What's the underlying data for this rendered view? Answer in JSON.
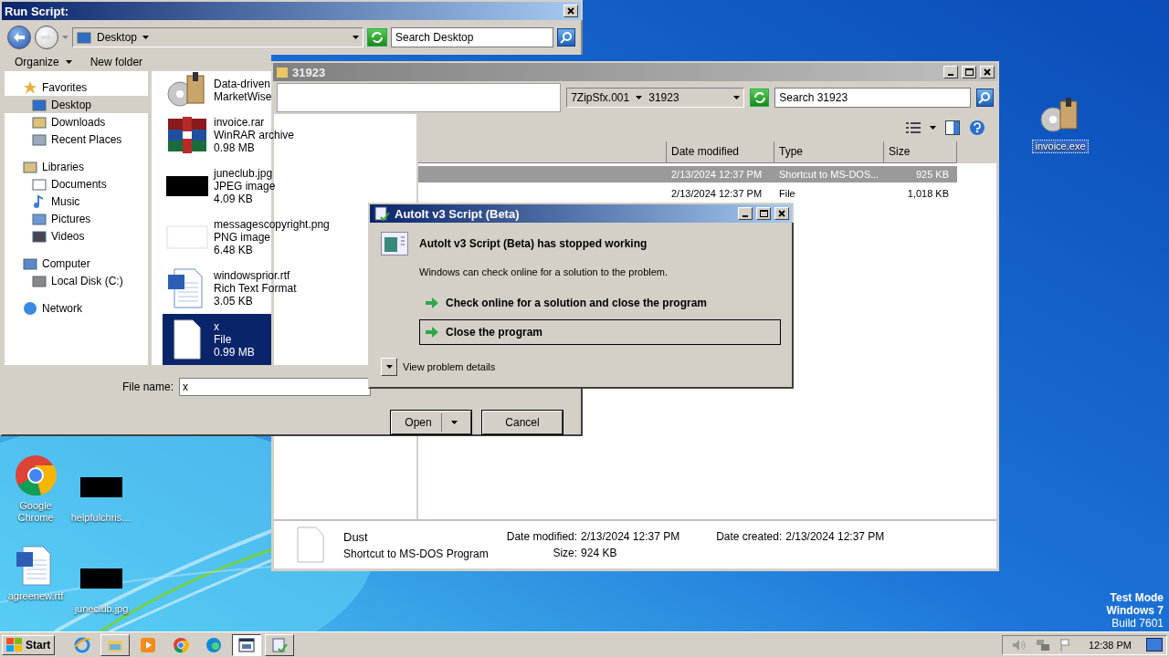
{
  "desktop": {
    "icons": [
      {
        "label": "Google Chrome",
        "kind": "chrome",
        "selected": false
      },
      {
        "label": "helpfulchris…",
        "kind": "dark-image",
        "selected": false
      },
      {
        "label": "agreenew.rtf",
        "kind": "word",
        "selected": false
      },
      {
        "label": "juneclub.jpg",
        "kind": "dark-image",
        "selected": false
      },
      {
        "label": "invoice.exe",
        "kind": "setup",
        "selected": true
      }
    ],
    "system_text": [
      "Test Mode",
      "Windows 7",
      "Build 7601"
    ]
  },
  "run_script": {
    "title": "Run Script:",
    "address": "Desktop",
    "search": {
      "placeholder": "Search Desktop"
    },
    "toolbar": [
      {
        "label": "Organize",
        "kind": "menu"
      },
      {
        "label": "New folder",
        "kind": "button"
      }
    ],
    "navigation": [
      {
        "label": "Favorites",
        "kind": "star",
        "selected": false,
        "children": [
          {
            "label": "Desktop",
            "kind": "desktop",
            "selected": true
          },
          {
            "label": "Downloads",
            "kind": "downloads",
            "selected": false
          },
          {
            "label": "Recent Places",
            "kind": "recent",
            "selected": false
          }
        ]
      },
      {
        "label": "Libraries",
        "kind": "library",
        "selected": false,
        "children": [
          {
            "label": "Documents",
            "kind": "document",
            "selected": false
          },
          {
            "label": "Music",
            "kind": "music",
            "selected": false
          },
          {
            "label": "Pictures",
            "kind": "picture",
            "selected": false
          },
          {
            "label": "Videos",
            "kind": "video",
            "selected": false
          }
        ]
      },
      {
        "label": "Computer",
        "kind": "computer",
        "selected": false,
        "children": [
          {
            "label": "Local Disk (C:)",
            "kind": "disk",
            "selected": false
          }
        ]
      },
      {
        "label": "Network",
        "kind": "network",
        "selected": false
      }
    ],
    "files": [
      {
        "kind": "setup",
        "lines": [
          "Data-driven",
          "MarketWise"
        ],
        "selected": false
      },
      {
        "kind": "archive",
        "lines": [
          "invoice.rar",
          "WinRAR archive",
          "0.98 MB"
        ],
        "selected": false
      },
      {
        "kind": "dark-image",
        "lines": [
          "juneclub.jpg",
          "JPEG image",
          "4.09 KB"
        ],
        "selected": false
      },
      {
        "kind": "blank-image",
        "lines": [
          "messagescopyright.png",
          "PNG image",
          "6.48 KB"
        ],
        "selected": false
      },
      {
        "kind": "word",
        "lines": [
          "windowsprior.rtf",
          "Rich Text Format",
          "3.05 KB"
        ],
        "selected": false
      },
      {
        "kind": "file",
        "lines": [
          "x",
          "File",
          "0.99 MB"
        ],
        "selected": true
      }
    ],
    "file_name": {
      "label": "File name:",
      "value": "x"
    },
    "buttons": [
      {
        "label": "Open",
        "kind": "split"
      },
      {
        "label": "Cancel",
        "kind": "plain"
      }
    ]
  },
  "explorer": {
    "title": "31923",
    "breadcrumb": [
      "7ZipSfx.001",
      "31923"
    ],
    "search": {
      "placeholder": "Search 31923"
    },
    "columns": [
      "Date modified",
      "Type",
      "Size"
    ],
    "rows": [
      {
        "cells": [
          "2/13/2024 12:37 PM",
          "Shortcut to MS-DOS...",
          "925 KB"
        ],
        "selected": true
      },
      {
        "cells": [
          "2/13/2024 12:37 PM",
          "File",
          "1,018 KB"
        ],
        "selected": false
      }
    ],
    "details": {
      "name": "Dust",
      "type": "Shortcut to MS-DOS Program",
      "fields": [
        {
          "label": "Date modified:",
          "value": "2/13/2024 12:37 PM"
        },
        {
          "label": "Size:",
          "value": "924 KB"
        },
        {
          "label": "Date created:",
          "value": "2/13/2024 12:37 PM"
        }
      ]
    }
  },
  "error_dialog": {
    "title": "AutoIt v3 Script (Beta)",
    "heading": "AutoIt v3 Script (Beta) has stopped working",
    "message": "Windows can check online for a solution to the problem.",
    "options": [
      {
        "label": "Check online for a solution and close the program",
        "focused": false
      },
      {
        "label": "Close the program",
        "focused": true
      }
    ],
    "details_toggle": "View problem details"
  },
  "taskbar": {
    "start": "Start",
    "apps": [
      {
        "kind": "ie",
        "open": false,
        "active": false
      },
      {
        "kind": "explorer",
        "open": true,
        "active": false
      },
      {
        "kind": "media",
        "open": false,
        "active": false
      },
      {
        "kind": "chrome",
        "open": false,
        "active": false
      },
      {
        "kind": "edge",
        "open": false,
        "active": false
      },
      {
        "kind": "window",
        "open": true,
        "active": true
      },
      {
        "kind": "autoit",
        "open": true,
        "active": false
      }
    ],
    "clock": "12:38 PM"
  }
}
